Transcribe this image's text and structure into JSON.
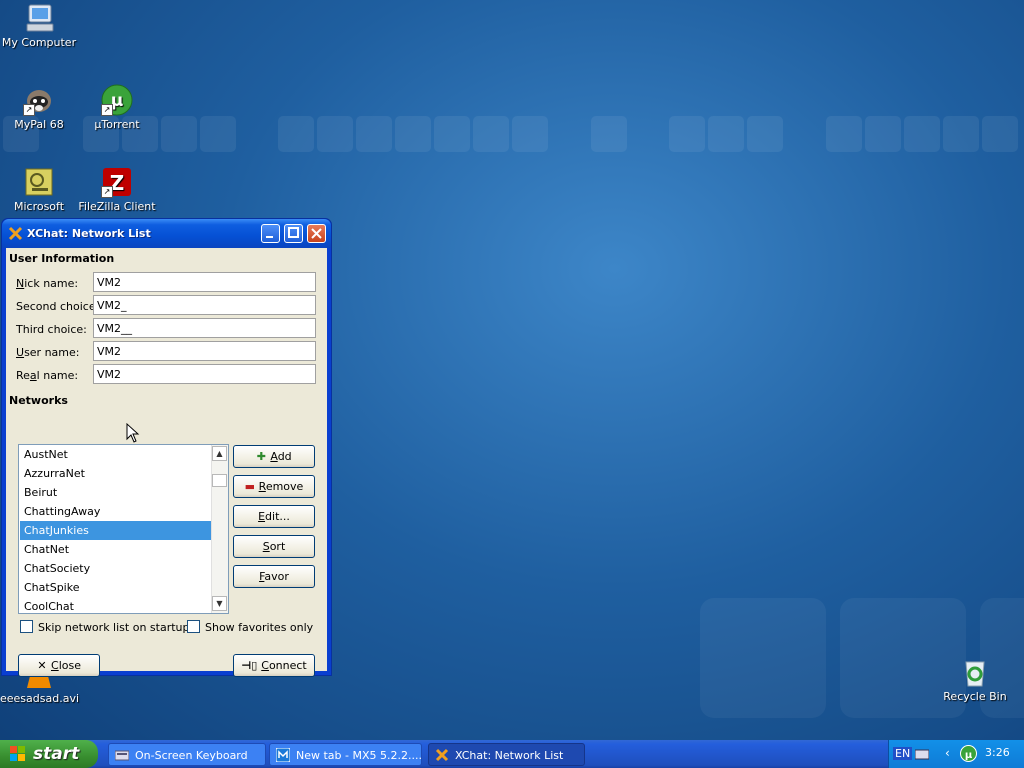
{
  "desktop": {
    "icons": [
      {
        "label": "My Computer",
        "icon": "my-computer-icon"
      },
      {
        "label": "MyPal 68",
        "icon": "mypal-icon"
      },
      {
        "label": "µTorrent",
        "icon": "utorrent-icon"
      },
      {
        "label": "Microsoft",
        "icon": "microsoft-icon"
      },
      {
        "label": "FileZilla Client",
        "icon": "filezilla-icon"
      },
      {
        "label": "eeesadsad.avi",
        "icon": "vlc-file-icon"
      },
      {
        "label": "Recycle Bin",
        "icon": "recycle-bin-icon"
      }
    ]
  },
  "window": {
    "title": "XChat: Network List",
    "user_info": {
      "heading": "User Information",
      "fields": [
        {
          "label_u": "N",
          "label_rest": "ick name:",
          "value": "VM2"
        },
        {
          "label_u": "",
          "label_rest": "Second choice:",
          "value": "VM2_"
        },
        {
          "label_u": "",
          "label_rest": "Third choice:",
          "value": "VM2__"
        },
        {
          "label_u": "U",
          "label_rest": "ser name:",
          "value": "VM2"
        },
        {
          "label_pre": "Re",
          "label_u": "a",
          "label_rest": "l name:",
          "value": "VM2"
        }
      ]
    },
    "networks": {
      "heading": "Networks",
      "items": [
        "AustNet",
        "AzzurraNet",
        "Beirut",
        "ChattingAway",
        "ChatJunkies",
        "ChatNet",
        "ChatSociety",
        "ChatSpike",
        "CoolChat"
      ],
      "selected": "ChatJunkies"
    },
    "buttons": {
      "add": {
        "u": "A",
        "rest": "dd",
        "icon": "plus-icon"
      },
      "remove": {
        "u": "R",
        "rest": "emove",
        "icon": "minus-icon"
      },
      "edit": {
        "u": "E",
        "rest": "dit..."
      },
      "sort": {
        "u": "S",
        "rest": "ort"
      },
      "favor": {
        "u": "F",
        "rest": "avor"
      },
      "close": {
        "u": "C",
        "rest": "lose",
        "icon": "x-icon"
      },
      "connect": {
        "u": "C",
        "rest": "onnect",
        "icon": "connect-plug-icon"
      }
    },
    "checkboxes": {
      "skip": "Skip network list on startup",
      "favorites": "Show favorites only"
    }
  },
  "taskbar": {
    "start_label": "start",
    "items": [
      {
        "label": "On-Screen Keyboard",
        "icon": "keyboard-icon"
      },
      {
        "label": "New tab - MX5 5.2.2....",
        "icon": "browser-icon"
      },
      {
        "label": "XChat: Network List",
        "icon": "xchat-icon",
        "active": true
      }
    ],
    "tray": {
      "lang": "EN",
      "time": "3:26"
    }
  },
  "colors": {
    "selection": "#3d95e0",
    "titlebar": "#0550d4",
    "desktop": "#1f5fa0"
  }
}
